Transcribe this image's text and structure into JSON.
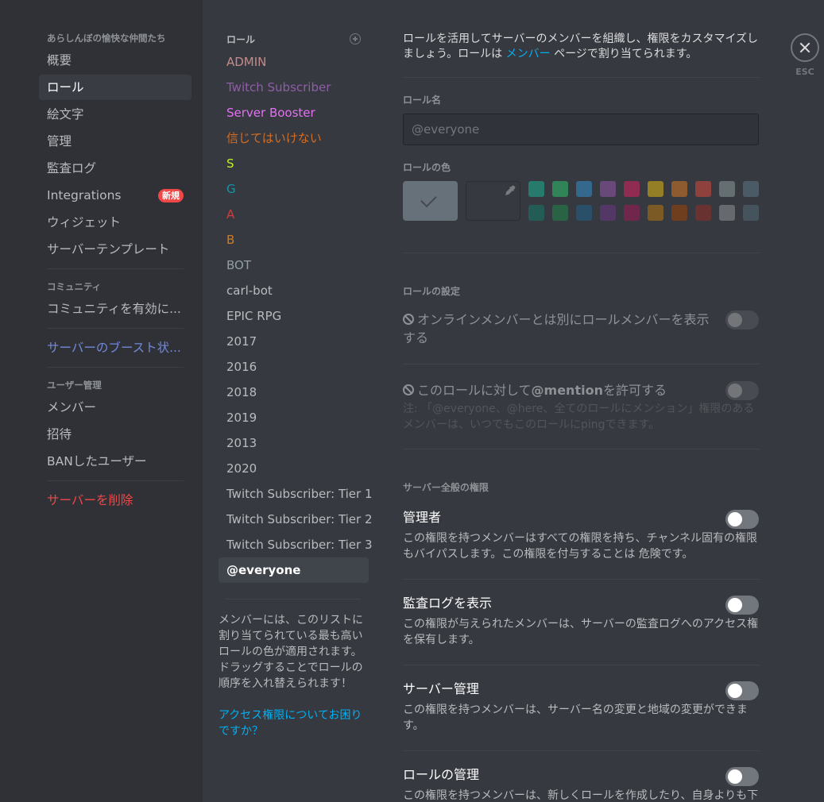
{
  "sidebar": {
    "server_header": "あらしんぼの愉快な仲間たち",
    "server_items": [
      {
        "label": "概要"
      },
      {
        "label": "ロール",
        "selected": true
      },
      {
        "label": "絵文字"
      },
      {
        "label": "管理"
      },
      {
        "label": "監査ログ"
      },
      {
        "label": "Integrations",
        "badge": "新規"
      },
      {
        "label": "ウィジェット"
      },
      {
        "label": "サーバーテンプレート"
      }
    ],
    "community_header": "コミュニティ",
    "community_item": "コミュニティを有効に...",
    "boost_item": "サーバーのブースト状...",
    "user_mgmt_header": "ユーザー管理",
    "user_mgmt_items": [
      {
        "label": "メンバー"
      },
      {
        "label": "招待"
      },
      {
        "label": "BANしたユーザー"
      }
    ],
    "delete_server": "サーバーを削除"
  },
  "roles": {
    "header": "ロール",
    "add_icon": "plus-circle-icon",
    "items": [
      {
        "name": "ADMIN",
        "color": "#c48b8b"
      },
      {
        "name": "Twitch Subscriber",
        "color": "#8e5ea9"
      },
      {
        "name": "Server Booster",
        "color": "#e470f2"
      },
      {
        "name": "信じてはいけない",
        "color": "#d26d25"
      },
      {
        "name": "S",
        "color": "#c3f02a"
      },
      {
        "name": "G",
        "color": "#1694a6"
      },
      {
        "name": "A",
        "color": "#d13d3d"
      },
      {
        "name": "B",
        "color": "#d27a25"
      },
      {
        "name": "BOT",
        "color": "#91a0a0"
      },
      {
        "name": "carl-bot",
        "color": "#b9bbbe"
      },
      {
        "name": "EPIC RPG",
        "color": "#b9bbbe"
      },
      {
        "name": "2017",
        "color": "#b9bbbe"
      },
      {
        "name": "2016",
        "color": "#b9bbbe"
      },
      {
        "name": "2018",
        "color": "#b9bbbe"
      },
      {
        "name": "2019",
        "color": "#b9bbbe"
      },
      {
        "name": "2013",
        "color": "#b9bbbe"
      },
      {
        "name": "2020",
        "color": "#b9bbbe"
      },
      {
        "name": "Twitch Subscriber: Tier 1",
        "color": "#b9bbbe"
      },
      {
        "name": "Twitch Subscriber: Tier 2",
        "color": "#b9bbbe"
      },
      {
        "name": "Twitch Subscriber: Tier 3",
        "color": "#b9bbbe"
      },
      {
        "name": "@everyone",
        "color": "#ffffff",
        "selected": true
      }
    ],
    "help_text": "メンバーには、このリストに割り当てられている最も高いロールの色が適用されます。ドラッグすることでロールの順序を入れ替えられます！",
    "help_link": "アクセス権限についてお困りですか？"
  },
  "main": {
    "intro_before": "ロールを活用してサーバーのメンバーを組織し、権限をカスタマイズしましょう。ロールは ",
    "intro_link": "メンバー",
    "intro_after": " ページで割り当てられます。",
    "role_name_label": "ロール名",
    "role_name_value": "@everyone",
    "role_color_label": "ロールの色",
    "default_color": "#99aab5",
    "picker_icon": "eyedropper-icon",
    "swatches_row1": [
      "#1abc9c",
      "#2ecc71",
      "#3498db",
      "#9b59b6",
      "#e91e63",
      "#f1c40f",
      "#e67e22",
      "#e74c3c",
      "#95a5a6",
      "#607d8b"
    ],
    "swatches_row2": [
      "#11806a",
      "#1f8b4c",
      "#206694",
      "#71368a",
      "#ad1457",
      "#c27c0e",
      "#a84300",
      "#992d22",
      "#979c9f",
      "#546e7a"
    ],
    "role_settings_label": "ロールの設定",
    "hoist_setting": {
      "title": "オンラインメンバーとは別にロールメンバーを表示する",
      "enabled": false,
      "disabled": true
    },
    "mention_setting": {
      "title_before": "このロールに対して",
      "title_bold": "@mention",
      "title_after": "を許可する",
      "note": "注: 「@everyone、@here、全てのロールにメンション」権限のあるメンバーは、いつでもこのロールにpingできます。",
      "enabled": false,
      "disabled": true
    },
    "general_perms_label": "サーバー全般の権限",
    "permissions": [
      {
        "title": "管理者",
        "desc": "この権限を持つメンバーはすべての権限を持ち、チャンネル固有の権限もバイパスします。この権限を付与することは 危険です。",
        "enabled": false
      },
      {
        "title": "監査ログを表示",
        "desc": "この権限が与えられたメンバーは、サーバーの監査ログへのアクセス権を保有します。",
        "enabled": false
      },
      {
        "title": "サーバー管理",
        "desc": "この権限を持つメンバーは、サーバー名の変更と地域の変更ができます。",
        "enabled": false
      },
      {
        "title": "ロールの管理",
        "desc": "この権限を持つメンバーは、新しくロールを作成したり、自身よりも下",
        "enabled": false
      }
    ]
  },
  "close": {
    "icon": "close-icon",
    "label": "ESC"
  }
}
